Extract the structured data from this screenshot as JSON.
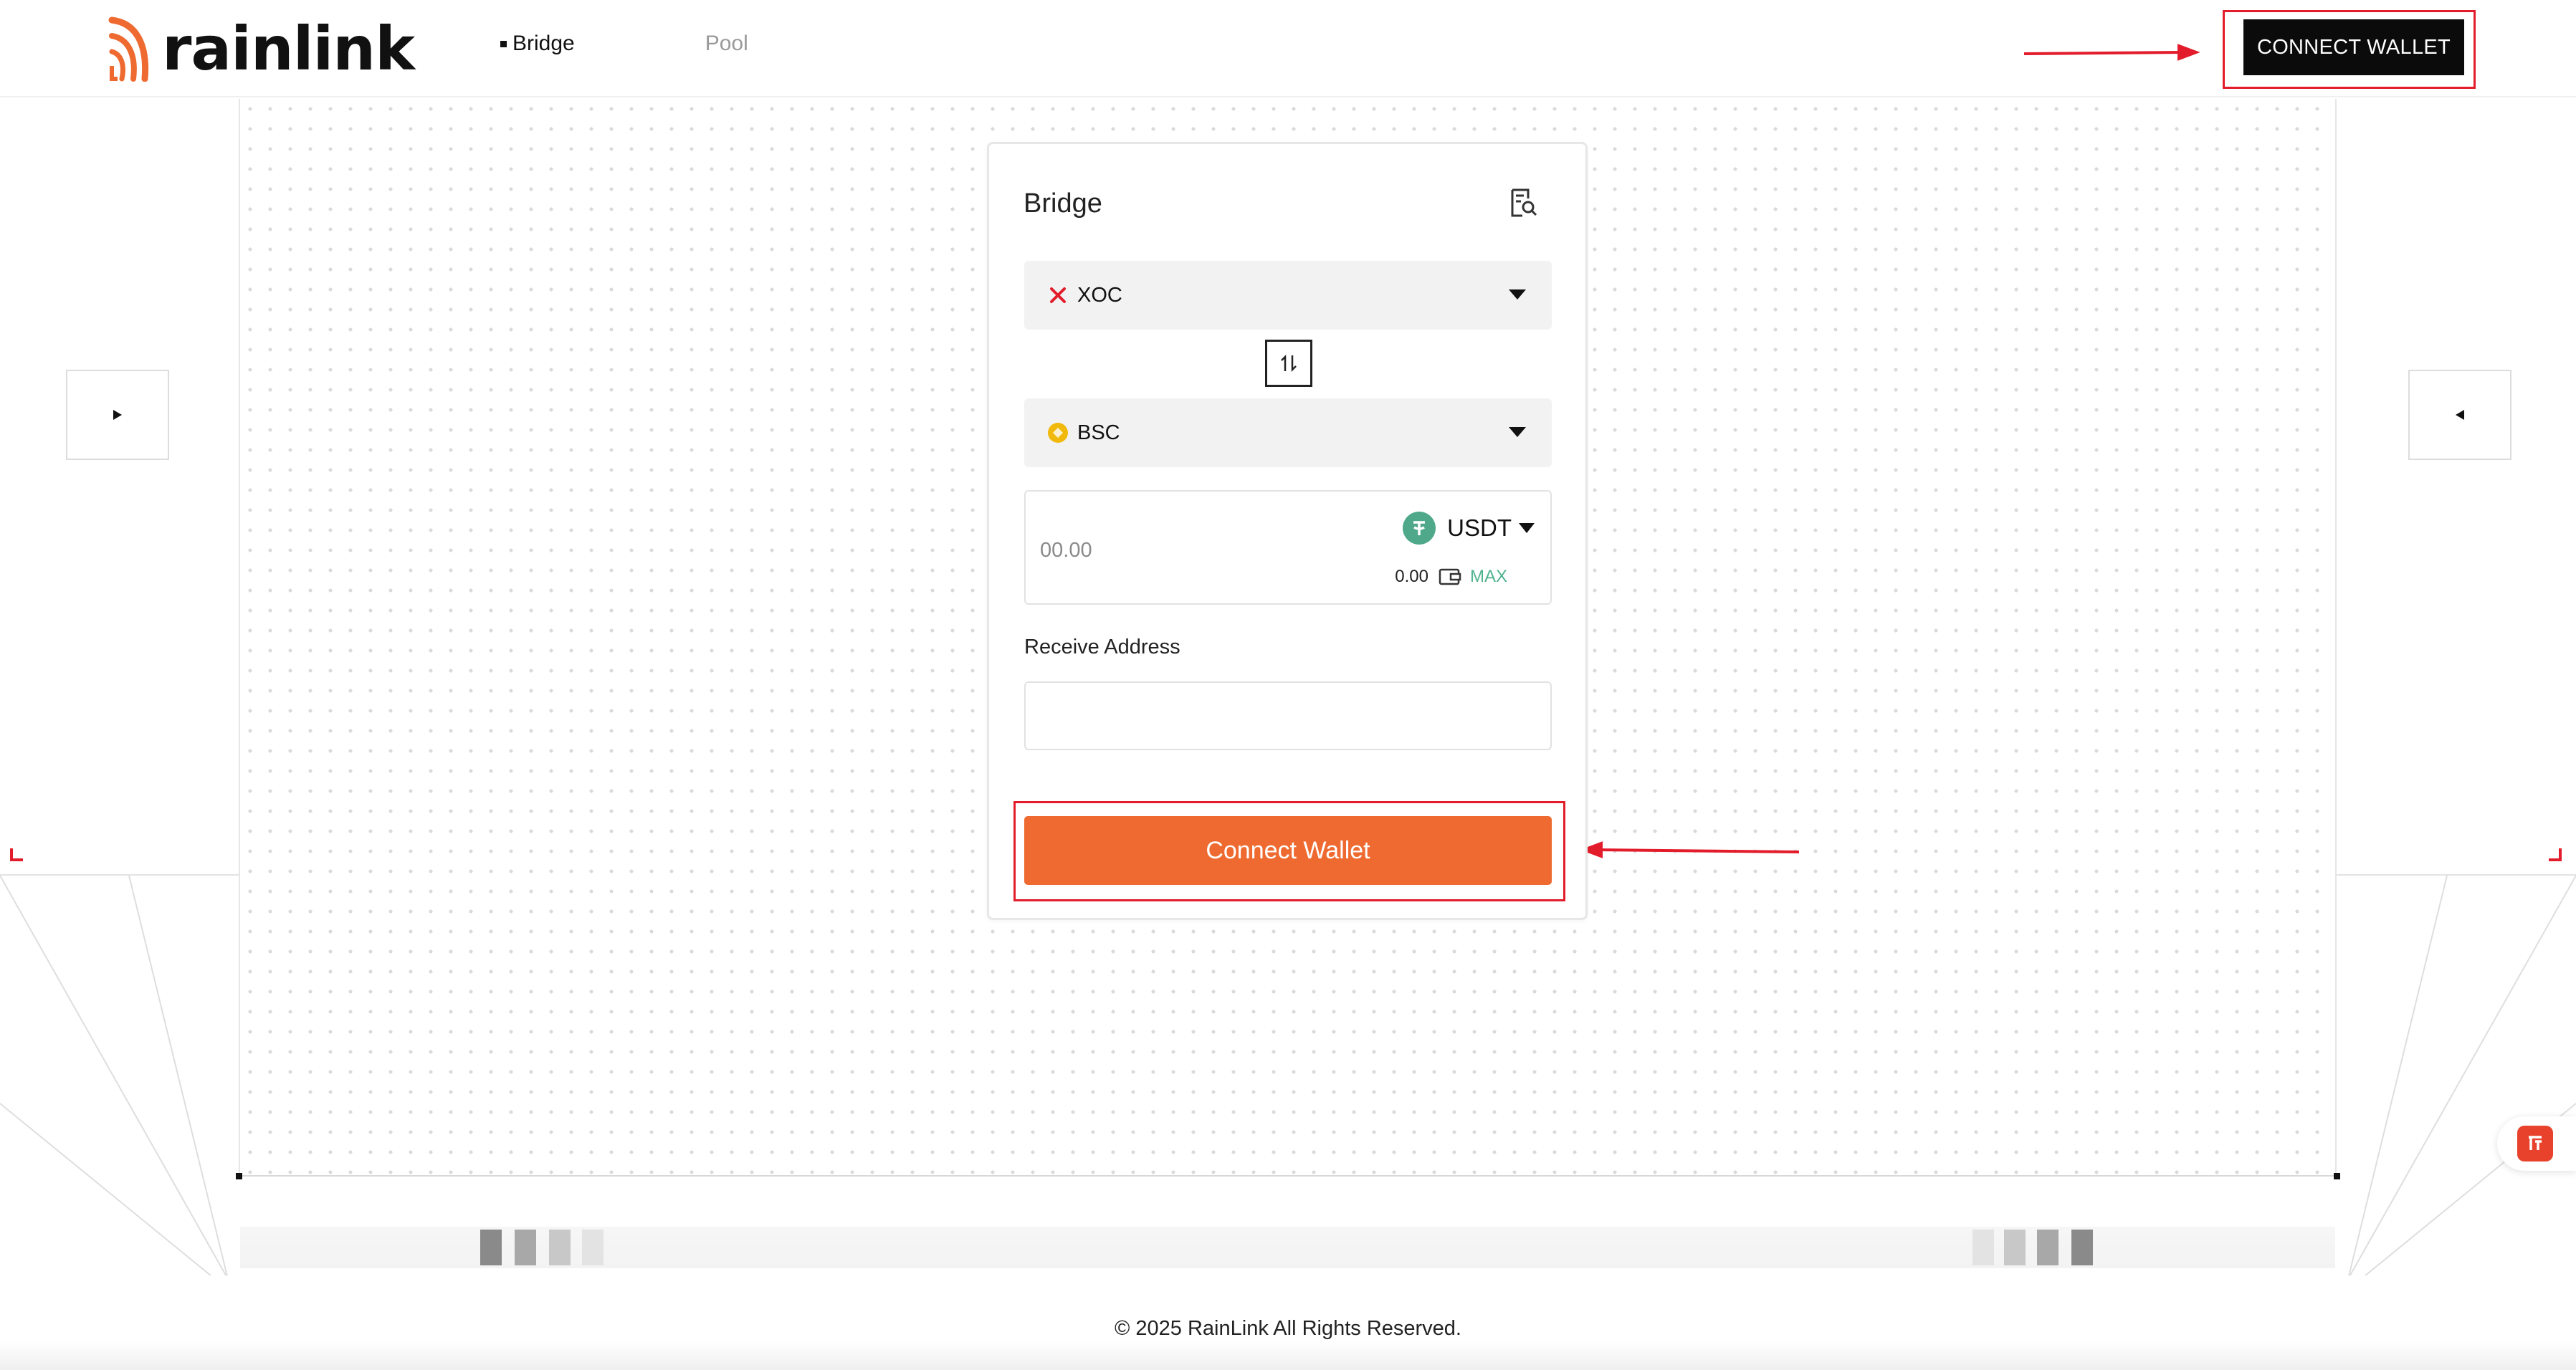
{
  "header": {
    "brand": "rainlink",
    "nav": [
      {
        "label": "Bridge",
        "active": true
      },
      {
        "label": "Pool",
        "active": false
      }
    ],
    "connect_label": "CONNECT WALLET"
  },
  "card": {
    "title": "Bridge",
    "from_chain": "XOC",
    "to_chain": "BSC",
    "amount_placeholder": "00.00",
    "token": "USDT",
    "balance": "0.00",
    "max_label": "MAX",
    "receive_label": "Receive Address",
    "receive_value": "",
    "connect_label": "Connect Wallet"
  },
  "footer": {
    "copyright": "© 2025 RainLink All Rights Reserved."
  },
  "colors": {
    "accent": "#ee6a30",
    "annotation": "#e21c2b",
    "token": "#4fa88a",
    "max": "#4fb38e"
  },
  "icons": [
    "rainlink-logo-icon",
    "history-search-icon",
    "xoc-chain-icon",
    "bsc-chain-icon",
    "swap-icon",
    "usdt-token-icon",
    "wallet-icon",
    "play-right-icon",
    "play-left-icon",
    "chat-support-icon"
  ]
}
